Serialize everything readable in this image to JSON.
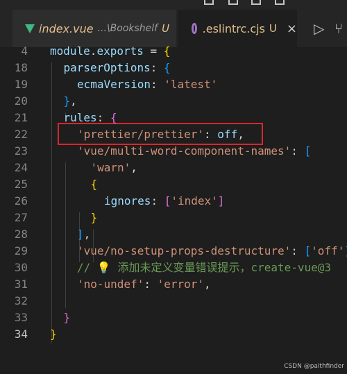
{
  "tabs": [
    {
      "label": "index.vue",
      "description": "...\\Bookshelf",
      "status": "U"
    },
    {
      "label": ".eslintrc.cjs",
      "status": "U",
      "close": "×"
    }
  ],
  "actions": {
    "run": "▷",
    "split": "⑂"
  },
  "code_lines": [
    {
      "num": "4",
      "tokens": [
        {
          "t": "module",
          "c": "k"
        },
        {
          "t": ".",
          "c": "p"
        },
        {
          "t": "exports",
          "c": "k"
        },
        {
          "t": " = ",
          "c": "p"
        },
        {
          "t": "{",
          "c": "b1"
        }
      ]
    },
    {
      "num": "18",
      "tokens": [
        {
          "t": "parserOptions",
          "c": "k"
        },
        {
          "t": ": ",
          "c": "p"
        },
        {
          "t": "{",
          "c": "b3"
        }
      ]
    },
    {
      "num": "19",
      "tokens": [
        {
          "t": "ecmaVersion",
          "c": "k"
        },
        {
          "t": ": ",
          "c": "p"
        },
        {
          "t": "'latest'",
          "c": "s"
        }
      ]
    },
    {
      "num": "20",
      "tokens": [
        {
          "t": "}",
          "c": "b3"
        },
        {
          "t": ",",
          "c": "p"
        }
      ]
    },
    {
      "num": "21",
      "tokens": [
        {
          "t": "rules",
          "c": "k"
        },
        {
          "t": ": ",
          "c": "p"
        },
        {
          "t": "{",
          "c": "b2"
        }
      ]
    },
    {
      "num": "22",
      "tokens": [
        {
          "t": "'prettier/prettier'",
          "c": "s"
        },
        {
          "t": ": ",
          "c": "p"
        },
        {
          "t": "off",
          "c": "k"
        },
        {
          "t": ",",
          "c": "p"
        }
      ]
    },
    {
      "num": "23",
      "tokens": [
        {
          "t": "'vue/multi-word-component-names'",
          "c": "s"
        },
        {
          "t": ": ",
          "c": "p"
        },
        {
          "t": "[",
          "c": "b3"
        }
      ]
    },
    {
      "num": "24",
      "tokens": [
        {
          "t": "'warn'",
          "c": "s"
        },
        {
          "t": ",",
          "c": "p"
        }
      ]
    },
    {
      "num": "25",
      "tokens": [
        {
          "t": "{",
          "c": "b1"
        }
      ]
    },
    {
      "num": "26",
      "tokens": [
        {
          "t": "ignores",
          "c": "k"
        },
        {
          "t": ": ",
          "c": "p"
        },
        {
          "t": "[",
          "c": "b2"
        },
        {
          "t": "'index'",
          "c": "s"
        },
        {
          "t": "]",
          "c": "b2"
        }
      ]
    },
    {
      "num": "27",
      "tokens": [
        {
          "t": "}",
          "c": "b1"
        }
      ]
    },
    {
      "num": "28",
      "tokens": [
        {
          "t": "]",
          "c": "b3"
        },
        {
          "t": ",",
          "c": "p"
        }
      ]
    },
    {
      "num": "29",
      "tokens": [
        {
          "t": "'vue/no-setup-props-destructure'",
          "c": "s"
        },
        {
          "t": ": ",
          "c": "p"
        },
        {
          "t": "[",
          "c": "b3"
        },
        {
          "t": "'off'",
          "c": "s"
        },
        {
          "t": "]",
          "c": "b3"
        }
      ]
    },
    {
      "num": "30",
      "tokens": [
        {
          "t": "// 💡 添加未定义变量错误提示，create-vue@3",
          "c": "c"
        }
      ]
    },
    {
      "num": "31",
      "tokens": [
        {
          "t": "'no-undef'",
          "c": "s"
        },
        {
          "t": ": ",
          "c": "p"
        },
        {
          "t": "'error'",
          "c": "s"
        },
        {
          "t": ",",
          "c": "p"
        }
      ]
    },
    {
      "num": "32",
      "tokens": []
    },
    {
      "num": "33",
      "tokens": [
        {
          "t": "}",
          "c": "b2"
        }
      ]
    },
    {
      "num": "34",
      "tokens": [
        {
          "t": "}",
          "c": "b1"
        }
      ]
    }
  ],
  "watermark": "CSDN @paithfinder"
}
